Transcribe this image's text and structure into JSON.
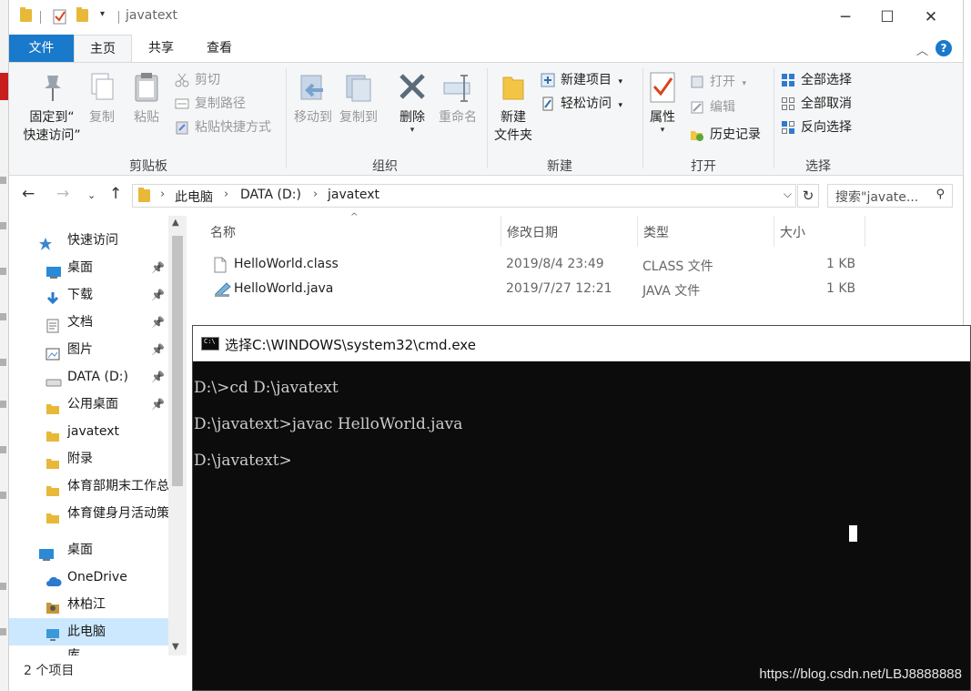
{
  "window": {
    "title": "javatext"
  },
  "ribbon": {
    "tabs": [
      "文件",
      "主页",
      "共享",
      "查看"
    ],
    "groups": {
      "clipboard": {
        "label": "剪贴板",
        "pin_label_1": "固定到“",
        "pin_label_2": "快速访问”",
        "copy": "复制",
        "paste": "粘贴",
        "cut": "剪切",
        "copy_path": "复制路径",
        "paste_shortcut": "粘贴快捷方式"
      },
      "organize": {
        "label": "组织",
        "move_to": "移动到",
        "copy_to": "复制到",
        "delete": "删除",
        "rename": "重命名"
      },
      "new": {
        "label": "新建",
        "new_folder_1": "新建",
        "new_folder_2": "文件夹",
        "new_item": "新建项目",
        "easy_access": "轻松访问"
      },
      "open": {
        "label": "打开",
        "properties": "属性",
        "open": "打开",
        "edit": "编辑",
        "history": "历史记录"
      },
      "select": {
        "label": "选择",
        "select_all": "全部选择",
        "select_none": "全部取消",
        "invert": "反向选择"
      }
    }
  },
  "address": {
    "crumbs": [
      "此电脑",
      "DATA (D:)",
      "javatext"
    ],
    "search_placeholder": "搜索\"javate..."
  },
  "nav": {
    "items": [
      {
        "label": "快速访问",
        "icon": "star-icon",
        "color": "#3a86d4"
      },
      {
        "label": "桌面",
        "icon": "desktop-icon",
        "color": "#2a8ad8",
        "pinned": true
      },
      {
        "label": "下载",
        "icon": "download-icon",
        "color": "#2a7ad0",
        "pinned": true
      },
      {
        "label": "文档",
        "icon": "document-icon",
        "color": "#777777",
        "pinned": true
      },
      {
        "label": "图片",
        "icon": "pictures-icon",
        "color": "#555555",
        "pinned": true
      },
      {
        "label": "DATA (D:)",
        "icon": "drive-icon",
        "color": "#888888",
        "pinned": true
      },
      {
        "label": "公用桌面",
        "icon": "folder-icon",
        "color": "#e8b838",
        "pinned": true
      },
      {
        "label": "javatext",
        "icon": "folder-icon",
        "color": "#e8b838"
      },
      {
        "label": "附录",
        "icon": "folder-icon",
        "color": "#e8b838"
      },
      {
        "label": "体育部期末工作总",
        "icon": "folder-icon",
        "color": "#e8b838"
      },
      {
        "label": "体育健身月活动策",
        "icon": "folder-icon",
        "color": "#e8b838"
      },
      {
        "label": "桌面",
        "icon": "desktop-icon",
        "color": "#2a8ad8"
      },
      {
        "label": "OneDrive",
        "icon": "cloud-icon",
        "color": "#2a7ad0"
      },
      {
        "label": "林柏江",
        "icon": "user-icon",
        "color": "#c8963a"
      },
      {
        "label": "此电脑",
        "icon": "computer-icon",
        "color": "#3a9ad8",
        "selected": true
      },
      {
        "label": "库",
        "icon": "library-icon",
        "color": "#e8b838"
      }
    ]
  },
  "files": {
    "headers": {
      "name": "名称",
      "date": "修改日期",
      "type": "类型",
      "size": "大小"
    },
    "rows": [
      {
        "name": "HelloWorld.class",
        "date": "2019/8/4 23:49",
        "type": "CLASS 文件",
        "size": "1 KB",
        "icon": "file-icon"
      },
      {
        "name": "HelloWorld.java",
        "date": "2019/7/27 12:21",
        "type": "JAVA 文件",
        "size": "1 KB",
        "icon": "java-file-icon"
      }
    ]
  },
  "status": {
    "count": "2 个项目"
  },
  "cmd": {
    "title": "选择C:\\WINDOWS\\system32\\cmd.exe",
    "icon_text": "C:\\",
    "lines": [
      "D:\\>cd D:\\javatext",
      "D:\\javatext>javac HelloWorld.java",
      "D:\\javatext>"
    ]
  },
  "watermark": "https://blog.csdn.net/LBJ8888888"
}
